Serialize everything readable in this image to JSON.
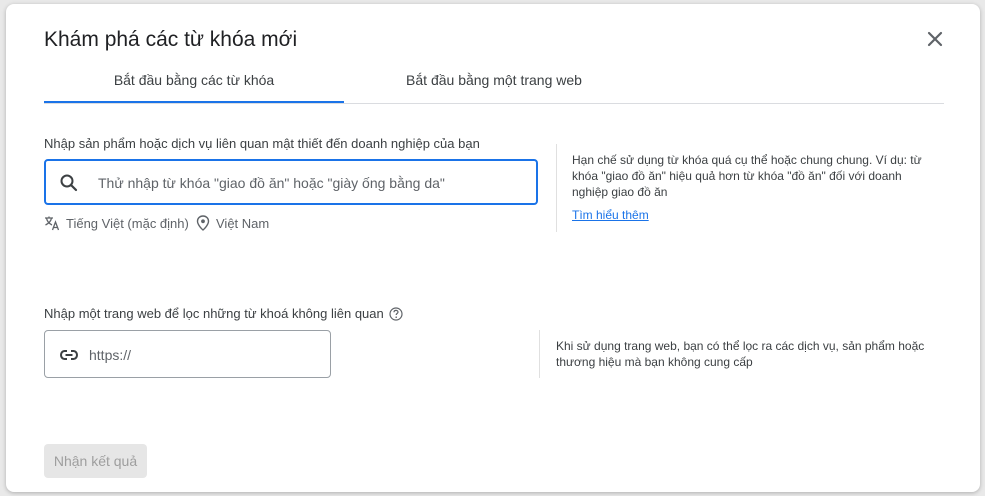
{
  "dialog": {
    "title": "Khám phá các từ khóa mới"
  },
  "tabs": [
    {
      "label": "Bắt đầu bằng các từ khóa",
      "active": true
    },
    {
      "label": "Bắt đầu bằng một trang web",
      "active": false
    }
  ],
  "keywords_section": {
    "label": "Nhập sản phẩm hoặc dịch vụ liên quan mật thiết đến doanh nghiệp của bạn",
    "search_placeholder": "Thử nhập từ khóa \"giao đồ ăn\" hoặc \"giày ống bằng da\"",
    "search_value": "",
    "language": "Tiếng Việt (mặc định)",
    "location": "Việt Nam",
    "hint": "Hạn chế sử dụng từ khóa quá cụ thể hoặc chung chung. Ví dụ: từ khóa \"giao đồ ăn\" hiệu quả hơn từ khóa \"đồ ăn\" đối với doanh nghiệp giao đồ ăn",
    "learn_more": "Tìm hiểu thêm"
  },
  "website_section": {
    "label": "Nhập một trang web để lọc những từ khoá không liên quan",
    "url_placeholder": "https://",
    "url_value": "",
    "hint": "Khi sử dụng trang web, bạn có thể lọc ra các dịch vụ, sản phẩm hoặc thương hiệu mà bạn không cung cấp"
  },
  "actions": {
    "submit_label": "Nhận kết quả",
    "submit_enabled": false
  },
  "colors": {
    "accent": "#1a73e8",
    "text": "#3c4043",
    "muted": "#5f6368",
    "disabled_bg": "#e6e6e6"
  },
  "icons": {
    "close": "close-icon",
    "search": "search-icon",
    "translate": "translate-icon",
    "location": "location-pin-icon",
    "help": "help-circle-icon",
    "link": "link-icon"
  }
}
